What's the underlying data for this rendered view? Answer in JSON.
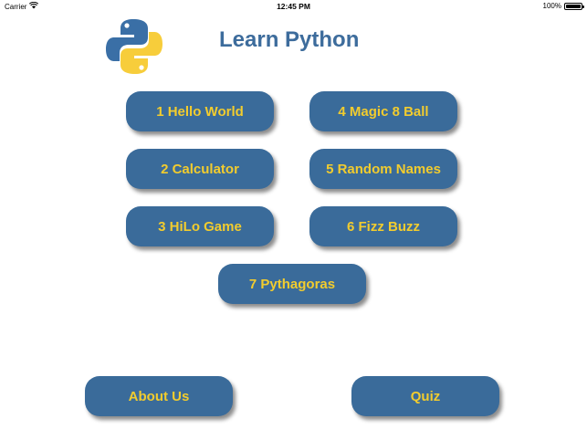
{
  "status_bar": {
    "carrier": "Carrier",
    "time": "12:45 PM",
    "battery": "100%",
    "battery_level": 1.0
  },
  "header": {
    "title": "Learn Python",
    "logo_icon": "python-logo-icon"
  },
  "lessons": [
    "1 Hello World",
    "2 Calculator",
    "3 HiLo Game",
    "4 Magic 8 Ball",
    "5 Random Names",
    "6 Fizz Buzz",
    "7 Pythagoras"
  ],
  "footer": {
    "about_label": "About Us",
    "quiz_label": "Quiz"
  },
  "colors": {
    "button_bg": "#3a6b9a",
    "button_text": "#f2cc2e",
    "title": "#3d6c9c",
    "python_blue": "#3a6fa6",
    "python_yellow": "#f7cd3b"
  }
}
